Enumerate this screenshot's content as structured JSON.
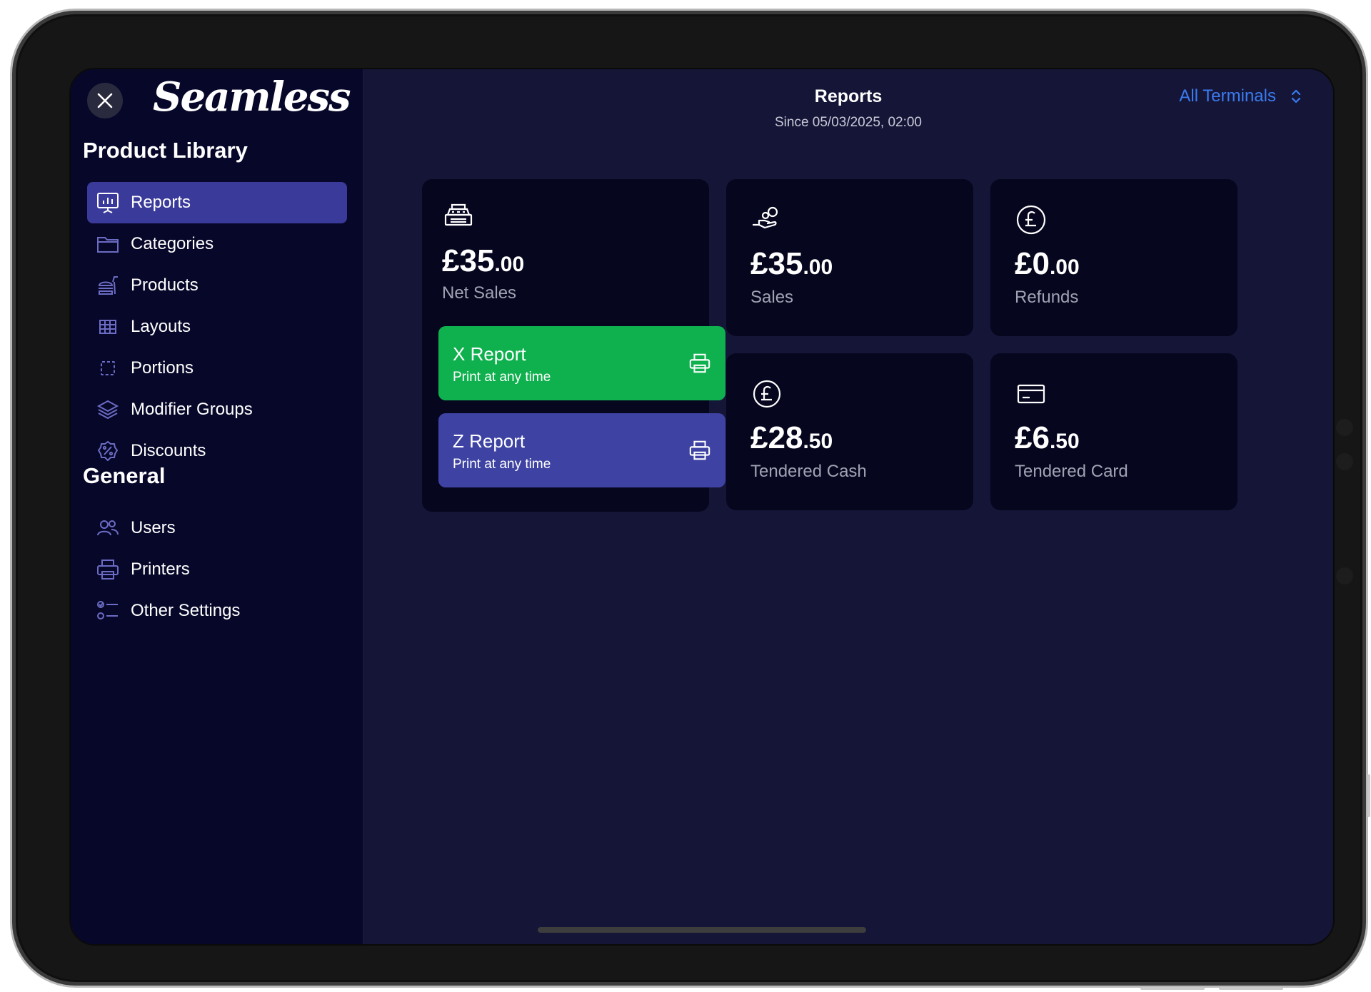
{
  "app": {
    "logo": "Seamless"
  },
  "sidebar": {
    "section_product": "Product Library",
    "product_items": [
      {
        "label": "Reports",
        "icon": "presentation-chart-icon",
        "active": true
      },
      {
        "label": "Categories",
        "icon": "folder-icon"
      },
      {
        "label": "Products",
        "icon": "fast-food-icon"
      },
      {
        "label": "Layouts",
        "icon": "table-icon"
      },
      {
        "label": "Portions",
        "icon": "portion-frame-icon"
      },
      {
        "label": "Modifier Groups",
        "icon": "layers-icon"
      },
      {
        "label": "Discounts",
        "icon": "percent-badge-icon"
      }
    ],
    "section_general": "General",
    "general_items": [
      {
        "label": "Users",
        "icon": "users-icon"
      },
      {
        "label": "Printers",
        "icon": "printer-icon"
      },
      {
        "label": "Other Settings",
        "icon": "settings-list-icon"
      }
    ]
  },
  "header": {
    "title": "Reports",
    "subtitle": "Since 05/03/2025, 02:00",
    "terminal_select": "All Terminals"
  },
  "cards": {
    "net_sales": {
      "currency": "£",
      "whole": "35",
      "fraction": ".00",
      "label": "Net Sales",
      "icon": "cash-register-icon"
    },
    "sales": {
      "currency": "£",
      "whole": "35",
      "fraction": ".00",
      "label": "Sales",
      "icon": "hand-coins-icon"
    },
    "refunds": {
      "currency": "£",
      "whole": "0",
      "fraction": ".00",
      "label": "Refunds",
      "icon": "pound-coin-icon"
    },
    "tendered_cash": {
      "currency": "£",
      "whole": "28",
      "fraction": ".50",
      "label": "Tendered Cash",
      "icon": "pound-coin-icon"
    },
    "tendered_card": {
      "currency": "£",
      "whole": "6",
      "fraction": ".50",
      "label": "Tendered Card",
      "icon": "credit-card-icon"
    }
  },
  "reports": {
    "x": {
      "title": "X Report",
      "subtitle": "Print at any time",
      "color": "#0fb14e"
    },
    "z": {
      "title": "Z Report",
      "subtitle": "Print at any time",
      "color": "#3e43a3"
    }
  },
  "colors": {
    "accent": "#3a3a9a",
    "link": "#3b7bf0",
    "sidebar_bg": "#07072a",
    "main_bg": "#151537",
    "card_bg": "#06061f"
  }
}
